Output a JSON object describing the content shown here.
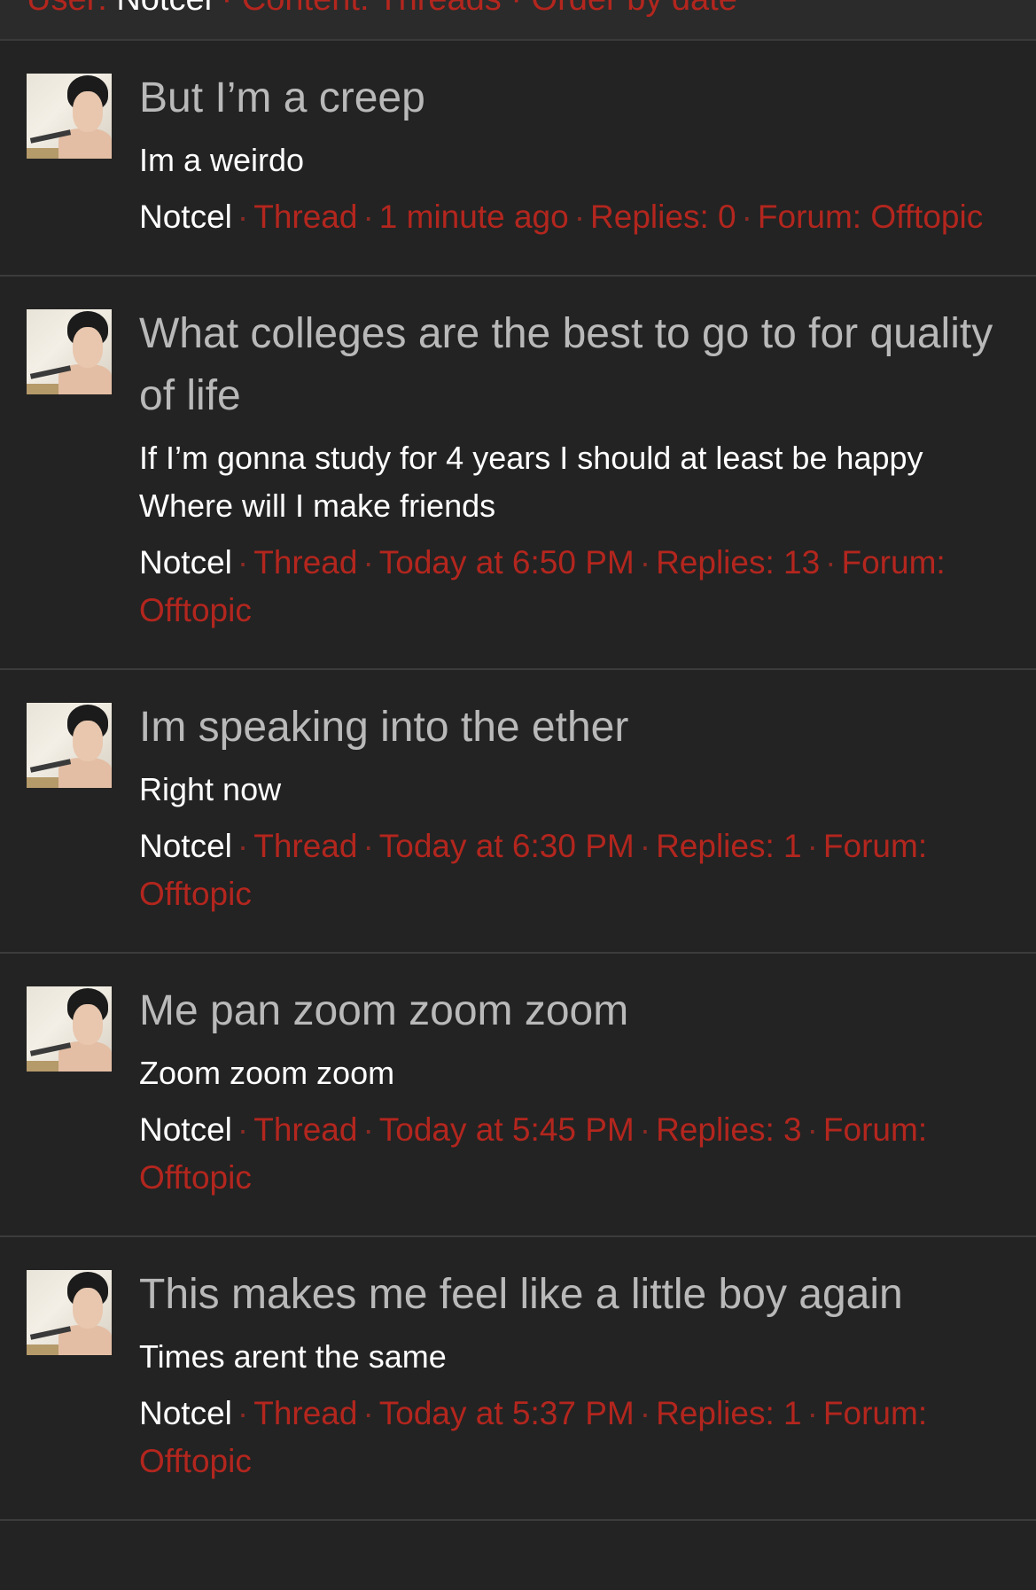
{
  "header": {
    "prefix": "User: ",
    "user": "Notcel",
    "suffix": " · Content: Threads · Order by date"
  },
  "results": [
    {
      "title": "But I’m a creep",
      "snippet": "Im a weirdo",
      "author": "Notcel",
      "type": "Thread",
      "time": "1 minute ago",
      "replies": "Replies: 0",
      "forum": "Forum: Offtopic"
    },
    {
      "title": "What colleges are the best to go to for quality of life",
      "snippet": "If I’m gonna study for 4 years I should at least be happy Where will I make friends",
      "author": "Notcel",
      "type": "Thread",
      "time": "Today at 6:50 PM",
      "replies": "Replies: 13",
      "forum": "Forum: Offtopic"
    },
    {
      "title": "Im speaking into the ether",
      "snippet": "Right now",
      "author": "Notcel",
      "type": "Thread",
      "time": "Today at 6:30 PM",
      "replies": "Replies: 1",
      "forum": "Forum: Offtopic"
    },
    {
      "title": "Me pan zoom zoom zoom",
      "snippet": "Zoom zoom zoom",
      "author": "Notcel",
      "type": "Thread",
      "time": "Today at 5:45 PM",
      "replies": "Replies: 3",
      "forum": "Forum: Offtopic"
    },
    {
      "title": "This makes me feel like a little boy again",
      "snippet": "Times arent the same",
      "author": "Notcel",
      "type": "Thread",
      "time": "Today at 5:37 PM",
      "replies": "Replies: 1",
      "forum": "Forum: Offtopic"
    }
  ],
  "colors": {
    "background": "#232323",
    "accent": "#b3261e",
    "title": "#b9b9b9",
    "snippet": "#ffffff"
  }
}
